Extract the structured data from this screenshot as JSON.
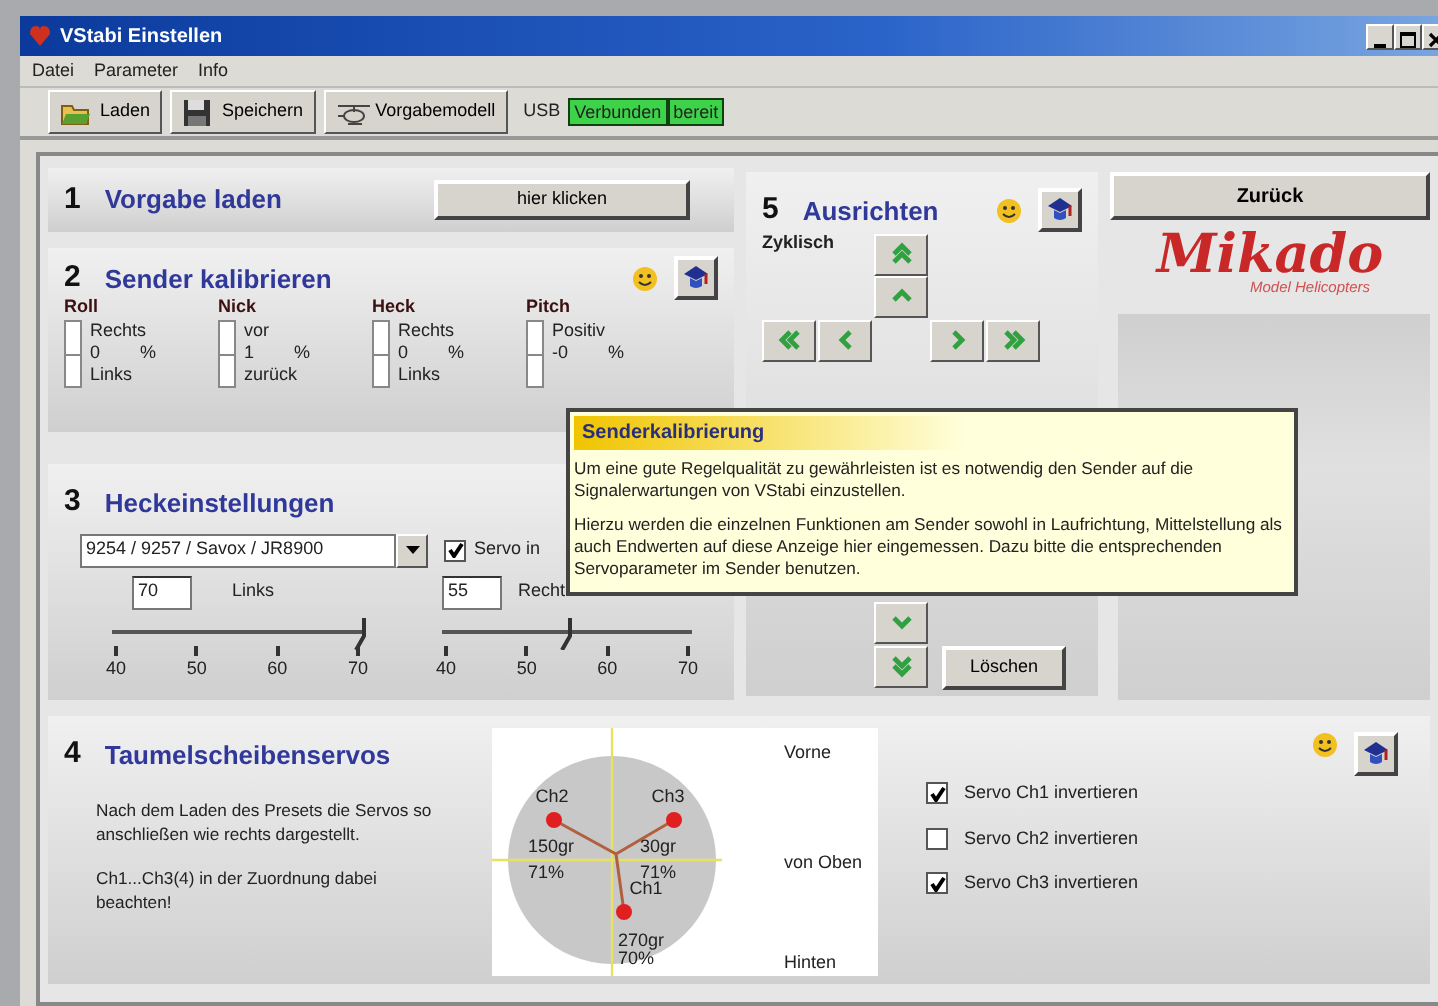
{
  "window": {
    "title": "VStabi Einstellen"
  },
  "menu": [
    "Datei",
    "Parameter",
    "Info"
  ],
  "toolbar": {
    "buttons": [
      {
        "label": "Laden",
        "kind": "open"
      },
      {
        "label": "Speichern",
        "kind": "save"
      },
      {
        "label": "Vorgabemodell",
        "kind": "model"
      }
    ],
    "usb_label": "USB",
    "status": [
      "Verbunden",
      "bereit"
    ]
  },
  "section_1": {
    "number": "1",
    "title": "Vorgabe laden",
    "button": "hier klicken"
  },
  "section_2": {
    "number": "2",
    "title": "Sender kalibrieren",
    "channels": [
      {
        "name": "Roll",
        "top": "Rechts",
        "value": "0",
        "unit": "%",
        "bottom": "Links"
      },
      {
        "name": "Nick",
        "top": "vor",
        "value": "1",
        "unit": "%",
        "bottom": "zurück"
      },
      {
        "name": "Heck",
        "top": "Rechts",
        "value": "0",
        "unit": "%",
        "bottom": "Links"
      },
      {
        "name": "Pitch",
        "top": "Positiv",
        "value": "-0",
        "unit": "%"
      }
    ]
  },
  "section_3": {
    "number": "3",
    "title": "Heckeinstellungen",
    "servo_type": "9254 / 9257 / Savox / JR8900",
    "checkbox": {
      "label": "Servo in",
      "checked": true
    },
    "sliders": [
      {
        "value": "70",
        "label": "Links",
        "level": 1,
        "ticks": [
          "40",
          "50",
          "60",
          "70"
        ]
      },
      {
        "value": "55",
        "label": "Recht",
        "level": 0.5,
        "ticks": [
          "40",
          "50",
          "60",
          "70"
        ]
      }
    ]
  },
  "section_5": {
    "number": "5",
    "title": "Ausrichten",
    "label": "Zyklisch",
    "clear_button": "Löschen"
  },
  "back_button": "Zurück",
  "logo": {
    "name": "Mikado",
    "tagline": "Model Helicopters"
  },
  "tooltip": {
    "title": "Senderkalibrierung",
    "paragraphs": [
      "Um eine gute Regelqualität zu gewährleisten ist es notwendig den Sender auf die Signalerwartungen von VStabi einzustellen.",
      "Hierzu werden die einzelnen Funktionen am Sender sowohl in Laufrichtung, Mittelstellung als auch Endwerten auf diese Anzeige hier eingemessen. Dazu bitte die entsprechenden Servoparameter im Sender benutzen."
    ]
  },
  "section_4": {
    "number": "4",
    "title": "Taumelscheibenservos",
    "description": [
      "Nach dem Laden des Presets die Servos so anschließen wie rechts dargestellt.",
      "Ch1...Ch3(4) in der Zuordnung dabei beachten!"
    ],
    "diagram": {
      "directions": [
        "Vorne",
        "von Oben",
        "Hinten"
      ],
      "servos": [
        {
          "name": "Ch2",
          "angle": "150gr",
          "percent": "71%"
        },
        {
          "name": "Ch3",
          "angle": "30gr",
          "percent": "71%"
        },
        {
          "name": "Ch1",
          "angle": "270gr",
          "percent": "70%"
        }
      ]
    },
    "invert": [
      {
        "label": "Servo Ch1 invertieren",
        "checked": true
      },
      {
        "label": "Servo Ch2 invertieren",
        "checked": false
      },
      {
        "label": "Servo Ch3 invertieren",
        "checked": true
      }
    ]
  }
}
